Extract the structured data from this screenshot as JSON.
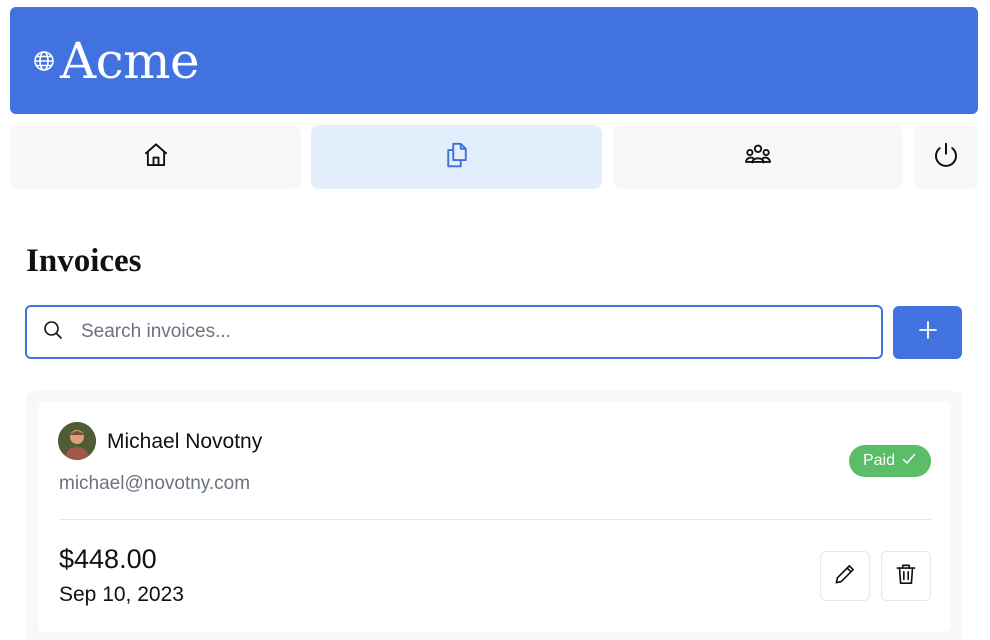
{
  "brand": {
    "name": "Acme",
    "icon": "globe-icon",
    "color": "#4172e0"
  },
  "nav": {
    "items": [
      {
        "id": "home",
        "icon": "home-icon",
        "active": false
      },
      {
        "id": "invoices",
        "icon": "documents-icon",
        "active": true
      },
      {
        "id": "customers",
        "icon": "users-icon",
        "active": false
      },
      {
        "id": "logout",
        "icon": "power-icon",
        "active": false
      }
    ]
  },
  "page": {
    "title": "Invoices"
  },
  "search": {
    "placeholder": "Search invoices...",
    "value": "",
    "icon": "search-icon"
  },
  "add_button": {
    "icon": "plus-icon"
  },
  "invoices": [
    {
      "customer_name": "Michael Novotny",
      "customer_email": "michael@novotny.com",
      "status": "Paid",
      "status_color": "#5bbd68",
      "amount": "$448.00",
      "date": "Sep 10, 2023",
      "actions": [
        "edit-icon",
        "trash-icon"
      ]
    }
  ]
}
